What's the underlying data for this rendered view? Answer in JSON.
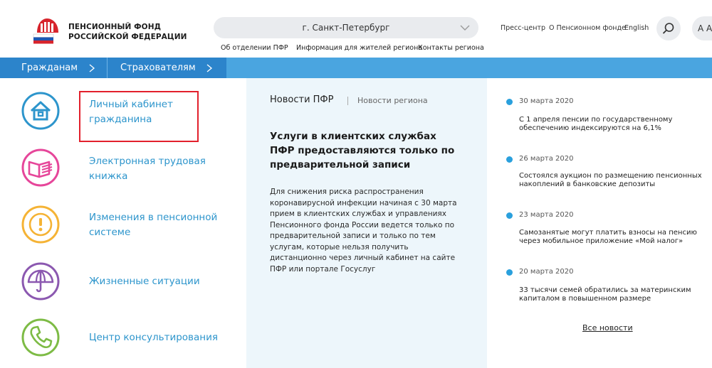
{
  "header": {
    "org_line1": "ПЕНСИОННЫЙ ФОНД",
    "org_line2": "РОССИЙСКОЙ ФЕДЕРАЦИИ",
    "city": "г. Санкт-Петербург",
    "sublinks": [
      "Об отделении ПФР",
      "Информация для жителей региона",
      "Контакты региона"
    ],
    "links": [
      "Пресс-центр",
      "О Пенсионном фонде",
      "English"
    ],
    "font_size_label": "A A"
  },
  "nav": {
    "items": [
      "Гражданам",
      "Страхователям"
    ]
  },
  "services": [
    {
      "line1": "Личный кабинет",
      "line2": "гражданина",
      "icon": "house-icon",
      "color": "#2d95cc"
    },
    {
      "line1": "Электронная трудовая",
      "line2": "книжка",
      "icon": "book-icon",
      "color": "#e6469a"
    },
    {
      "line1": "Изменения в пенсионной",
      "line2": "системе",
      "icon": "warning-icon",
      "color": "#f5b335"
    },
    {
      "line1": "Жизненные ситуации",
      "line2": "",
      "icon": "umbrella-icon",
      "color": "#8b58b0"
    },
    {
      "line1": "Центр консультирования",
      "line2": "",
      "icon": "phone-icon",
      "color": "#7dbb45"
    }
  ],
  "news_tabs": {
    "main": "Новости ПФР",
    "region": "Новости региона"
  },
  "featured": {
    "title": "Услуги в клиентских службах ПФР предоставляются только по предварительной записи",
    "body_lines": [
      "Для снижения риска распространения",
      "коронавирусной инфекции начиная с 30 марта",
      "прием в клиентских службах и управлениях",
      "Пенсионного фонда России ведется только по",
      "предварительной записи и только по тем",
      "услугам, которые нельзя получить",
      "дистанционно через личный кабинет на сайте",
      "ПФР или портале Госуслуг"
    ]
  },
  "news": [
    {
      "date": "30 марта 2020",
      "line1": "С 1 апреля пенсии по государственному",
      "line2": "обеспечению индексируются на 6,1%"
    },
    {
      "date": "26 марта 2020",
      "line1": "Состоялся аукцион по размещению пенсионных",
      "line2": "накоплений в банковские депозиты"
    },
    {
      "date": "23 марта 2020",
      "line1": "Самозанятые могут платить взносы на пенсию",
      "line2": "через мобильное приложение «Мой налог»"
    },
    {
      "date": "20 марта 2020",
      "line1": "33 тысячи семей обратились за материнским",
      "line2": "капиталом в повышенном размере"
    }
  ],
  "all_news": "Все новости",
  "colors": {
    "nav_light": "#4aa5e0",
    "nav_dark": "#2c84cb",
    "accent_blue": "#2d95cc",
    "highlight_red": "#e2202c",
    "dot_blue": "#2aa0dd"
  }
}
